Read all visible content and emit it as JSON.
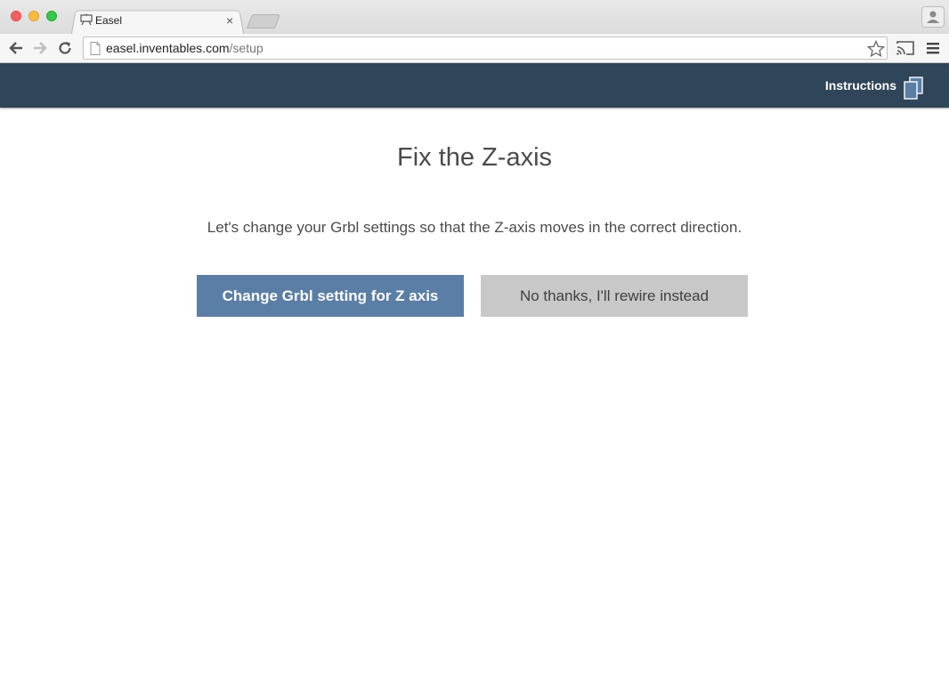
{
  "browser": {
    "tab_title": "Easel",
    "tab_close": "×",
    "url_host": "easel.inventables.com",
    "url_path": "/setup"
  },
  "header": {
    "instructions_label": "Instructions",
    "background_color": "#2f4559"
  },
  "main": {
    "title": "Fix the Z-axis",
    "description": "Let's change your Grbl settings so that the Z-axis moves in the correct direction.",
    "primary_button": "Change Grbl setting for Z axis",
    "secondary_button": "No thanks, I'll rewire instead"
  },
  "colors": {
    "primary_button": "#5a7ea6",
    "secondary_button": "#c8c8c8",
    "text": "#4b4b4b"
  },
  "icons": {
    "tab_favicon": "easel-icon",
    "back": "arrow-left-icon",
    "forward": "arrow-right-icon",
    "reload": "reload-icon",
    "page": "page-icon",
    "bookmark": "star-icon",
    "cast": "cast-icon",
    "menu": "hamburger-menu-icon",
    "profile": "person-icon",
    "instructions": "copy-pages-icon"
  }
}
